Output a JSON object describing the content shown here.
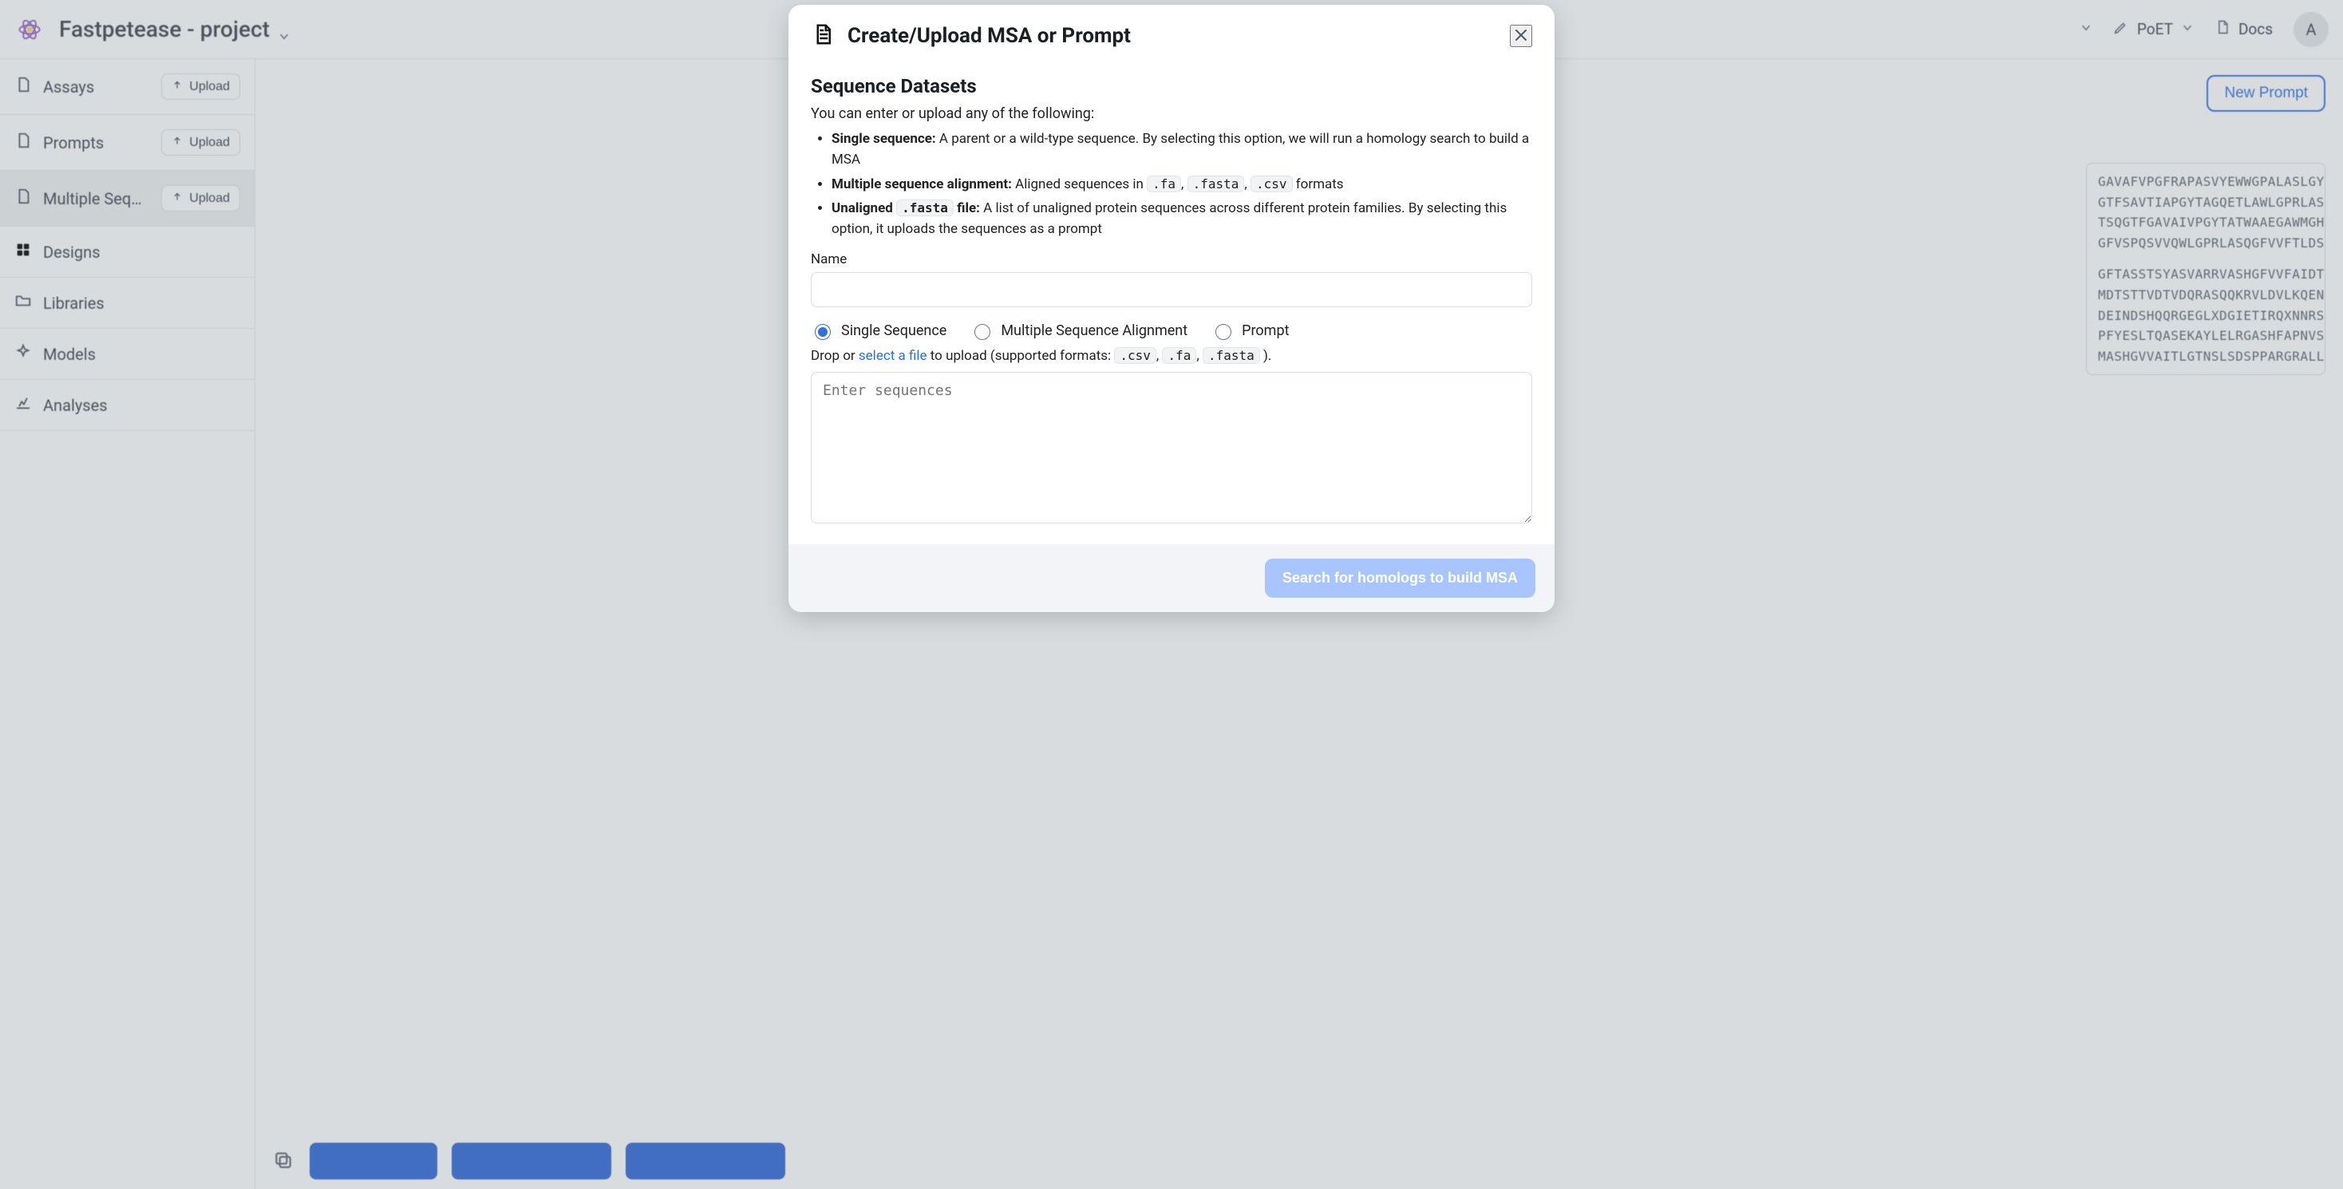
{
  "app": {
    "project_title": "Fastpetease - project",
    "poet_label": "PoET",
    "docs_label": "Docs",
    "avatar_initial": "A"
  },
  "sidebar": {
    "items": [
      {
        "label": "Assays",
        "upload": "Upload",
        "active": false,
        "has_upload": true
      },
      {
        "label": "Prompts",
        "upload": "Upload",
        "active": false,
        "has_upload": true
      },
      {
        "label": "Multiple Sequence Alignments",
        "upload": "Upload",
        "active": true,
        "has_upload": true
      },
      {
        "label": "Designs",
        "upload": "",
        "active": false,
        "has_upload": false
      },
      {
        "label": "Libraries",
        "upload": "",
        "active": false,
        "has_upload": false
      },
      {
        "label": "Models",
        "upload": "",
        "active": false,
        "has_upload": false
      },
      {
        "label": "Analyses",
        "upload": "",
        "active": false,
        "has_upload": false
      }
    ]
  },
  "main": {
    "new_prompt": "New Prompt",
    "sequence_preview": [
      "GAVAFVPGFRAPASVYEWWGPALASLGYSVF",
      "GTFSAVTIAPGYTAGQETLAWLGPRLASQGF",
      "TSQGTFGAVAIVPGYTATWAAEGAWMGHWLA",
      "GFVSPQSVVQWLGPRLASQGFVVFTLDSNGL",
      "",
      "GFTASSTSYASVARRVASHGFVVFAIDTNSR",
      "MDTSTTVDTVDQRASQQKRVLDVLKQENTRS",
      "DEINDSHQQRGEGLXDGIETIRQXNNRSASP",
      "PFYESLTQASEKAYLELRGASHFAPNVSNTT",
      "MASHGVVAITLGTNSLSDSPPARGRALLDAL"
    ],
    "bottom_buttons": [
      "",
      "",
      ""
    ]
  },
  "modal": {
    "title": "Create/Upload MSA or Prompt",
    "section_title": "Sequence Datasets",
    "lead": "You can enter or upload any of the following:",
    "bullets": {
      "single_label": "Single sequence:",
      "single_desc_a": " A parent or a wild-type sequence. By selecting this option, we will run a homology search to build a MSA",
      "msa_label": "Multiple sequence alignment:",
      "msa_desc_prefix": " Aligned sequences in ",
      "msa_formats": [
        ".fa",
        ".fasta",
        ".csv"
      ],
      "msa_desc_suffix": " formats",
      "unaligned_label_prefix": "Unaligned ",
      "unaligned_code": ".fasta",
      "unaligned_label_suffix": " file:",
      "unaligned_desc": " A list of unaligned protein sequences across different protein families. By selecting this option, it uploads the sequences as a prompt"
    },
    "name_label": "Name",
    "name_value": "",
    "radios": {
      "single": "Single Sequence",
      "msa": "Multiple Sequence Alignment",
      "prompt": "Prompt",
      "selected": "single"
    },
    "drop": {
      "prefix": "Drop or ",
      "link": "select a file",
      "mid": " to upload (supported formats: ",
      "formats": [
        ".csv",
        ".fa",
        ".fasta"
      ],
      "suffix": ")."
    },
    "sequence_placeholder": "Enter sequences",
    "submit_label": "Search for homologs to build MSA"
  }
}
